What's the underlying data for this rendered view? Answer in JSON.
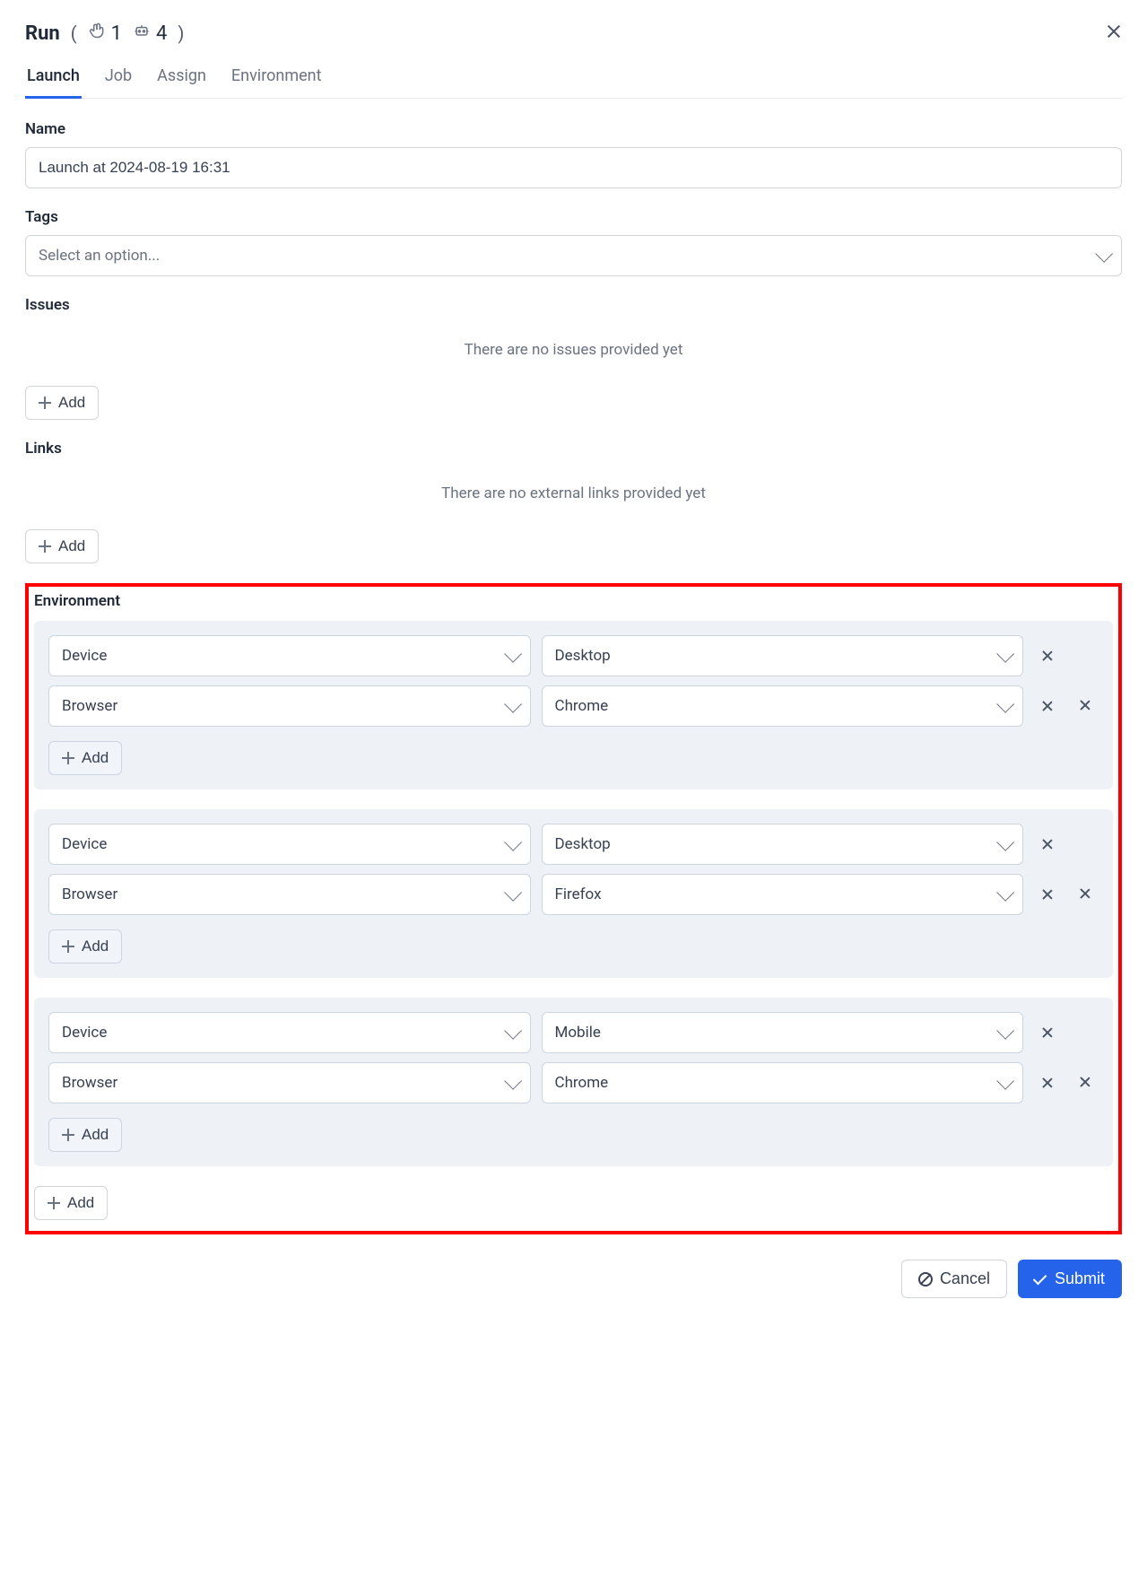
{
  "header": {
    "title": "Run",
    "manual_count": "1",
    "auto_count": "4"
  },
  "tabs": [
    {
      "label": "Launch",
      "active": true
    },
    {
      "label": "Job",
      "active": false
    },
    {
      "label": "Assign",
      "active": false
    },
    {
      "label": "Environment",
      "active": false
    }
  ],
  "fields": {
    "name_label": "Name",
    "name_value": "Launch at 2024-08-19 16:31",
    "tags_label": "Tags",
    "tags_placeholder": "Select an option...",
    "issues_label": "Issues",
    "issues_empty": "There are no issues provided yet",
    "links_label": "Links",
    "links_empty": "There are no external links provided yet",
    "env_label": "Environment"
  },
  "buttons": {
    "add": "Add",
    "cancel": "Cancel",
    "submit": "Submit"
  },
  "environments": [
    {
      "rows": [
        {
          "key": "Device",
          "value": "Desktop"
        },
        {
          "key": "Browser",
          "value": "Chrome"
        }
      ]
    },
    {
      "rows": [
        {
          "key": "Device",
          "value": "Desktop"
        },
        {
          "key": "Browser",
          "value": "Firefox"
        }
      ]
    },
    {
      "rows": [
        {
          "key": "Device",
          "value": "Mobile"
        },
        {
          "key": "Browser",
          "value": "Chrome"
        }
      ]
    }
  ]
}
